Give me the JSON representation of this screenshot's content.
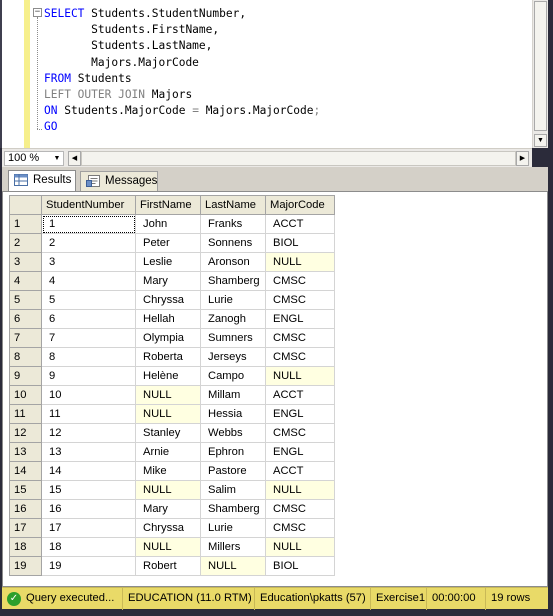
{
  "editor": {
    "lines": [
      [
        {
          "t": "SELECT",
          "c": "kw"
        },
        {
          "t": " Students.StudentNumber,",
          "c": "id"
        }
      ],
      [
        {
          "t": "       Students.FirstName,",
          "c": "id"
        }
      ],
      [
        {
          "t": "       Students.LastName,",
          "c": "id"
        }
      ],
      [
        {
          "t": "       Majors.MajorCode",
          "c": "id"
        }
      ],
      [
        {
          "t": "FROM",
          "c": "kw"
        },
        {
          "t": " Students",
          "c": "id"
        }
      ],
      [
        {
          "t": "LEFT OUTER JOIN",
          "c": "gray"
        },
        {
          "t": " Majors",
          "c": "id"
        }
      ],
      [
        {
          "t": "ON",
          "c": "kw"
        },
        {
          "t": " Students.MajorCode ",
          "c": "id"
        },
        {
          "t": "=",
          "c": "gray"
        },
        {
          "t": " Majors.MajorCode",
          "c": "id"
        },
        {
          "t": ";",
          "c": "gray"
        }
      ],
      [
        {
          "t": "GO",
          "c": "kw"
        }
      ]
    ],
    "collapse_glyph": "−"
  },
  "zoom": {
    "value": "100 %"
  },
  "tabs": {
    "results_label": "Results",
    "messages_label": "Messages"
  },
  "grid": {
    "columns": [
      "StudentNumber",
      "FirstName",
      "LastName",
      "MajorCode"
    ],
    "rows": [
      [
        "1",
        "John",
        "Franks",
        "ACCT"
      ],
      [
        "2",
        "Peter",
        "Sonnens",
        "BIOL"
      ],
      [
        "3",
        "Leslie",
        "Aronson",
        "NULL"
      ],
      [
        "4",
        "Mary",
        "Shamberg",
        "CMSC"
      ],
      [
        "5",
        "Chryssa",
        "Lurie",
        "CMSC"
      ],
      [
        "6",
        "Hellah",
        "Zanogh",
        "ENGL"
      ],
      [
        "7",
        "Olympia",
        "Sumners",
        "CMSC"
      ],
      [
        "8",
        "Roberta",
        "Jerseys",
        "CMSC"
      ],
      [
        "9",
        "Helène",
        "Campo",
        "NULL"
      ],
      [
        "10",
        "NULL",
        "Millam",
        "ACCT"
      ],
      [
        "11",
        "NULL",
        "Hessia",
        "ENGL"
      ],
      [
        "12",
        "Stanley",
        "Webbs",
        "CMSC"
      ],
      [
        "13",
        "Arnie",
        "Ephron",
        "ENGL"
      ],
      [
        "14",
        "Mike",
        "Pastore",
        "ACCT"
      ],
      [
        "15",
        "NULL",
        "Salim",
        "NULL"
      ],
      [
        "16",
        "Mary",
        "Shamberg",
        "CMSC"
      ],
      [
        "17",
        "Chryssa",
        "Lurie",
        "CMSC"
      ],
      [
        "18",
        "NULL",
        "Millers",
        "NULL"
      ],
      [
        "19",
        "Robert",
        "NULL",
        "BIOL"
      ]
    ]
  },
  "status": {
    "query": "Query executed...",
    "server": "EDUCATION (11.0 RTM)",
    "user": "Education\\pkatts (57)",
    "database": "Exercise1",
    "time": "00:00:00",
    "rows": "19 rows"
  },
  "colors": {
    "editor_margin": "#f6ef8c",
    "null_cell": "#ffffe1",
    "status_bar": "#e9da68",
    "keyword": "#0000ff",
    "operator": "#808080"
  }
}
